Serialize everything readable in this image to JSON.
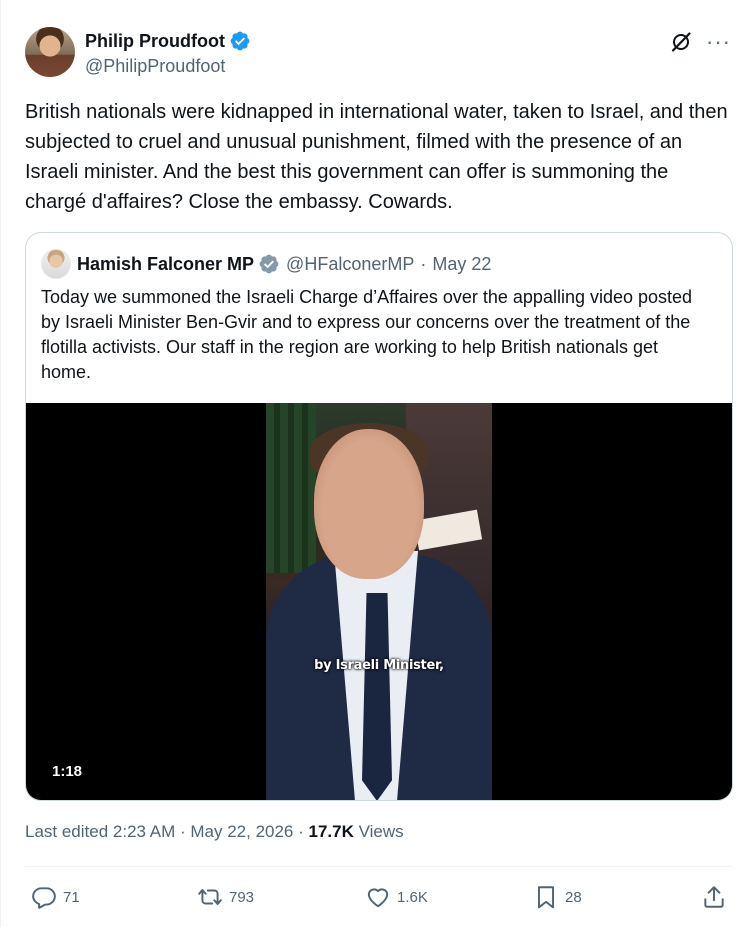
{
  "author": {
    "name": "Philip Proudfoot",
    "handle": "@PhilipProudfoot"
  },
  "tweet": {
    "text": "British nationals were kidnapped in international water, taken to Israel, and then subjected to cruel and unusual punishment, filmed with the presence of an Israeli minister. And the best this government can offer is summoning the chargé d'affaires? Close the embassy. Cowards."
  },
  "quoted": {
    "name": "Hamish Falconer MP",
    "handle": "@HFalconerMP",
    "separator": "·",
    "date": "May 22",
    "text": "Today we summoned the Israeli Charge d’Affaires over the appalling video posted by Israeli Minister Ben-Gvir and to express our concerns over the treatment of the flotilla activists. Our staff in the region are working to help British nationals get home.",
    "video": {
      "subtitle": "by Israeli Minister,",
      "duration": "1:18"
    }
  },
  "meta": {
    "edited": "Last edited 2:23 AM · May 22, 2026 · ",
    "views_count": "17.7K",
    "views_label": " Views"
  },
  "actions": {
    "replies": "71",
    "reposts": "793",
    "likes": "1.6K",
    "bookmarks": "28"
  },
  "colors": {
    "verified_badge": "#1d9bf0",
    "government_badge": "#829aab",
    "secondary_text": "#536471",
    "primary_text": "#0f1419"
  },
  "icons": [
    "verified-badge-icon",
    "grok-icon",
    "more-icon",
    "reply-icon",
    "repost-icon",
    "like-icon",
    "bookmark-icon",
    "share-icon"
  ]
}
